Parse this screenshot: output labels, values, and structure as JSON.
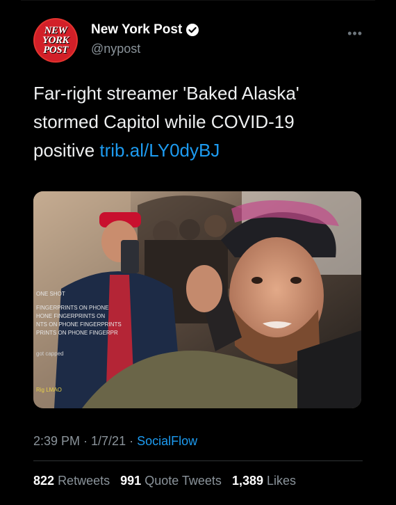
{
  "account": {
    "display_name": "New York Post",
    "handle": "@nypost",
    "logo_lines": [
      "NEW",
      "YORK",
      "POST"
    ],
    "verified": true
  },
  "tweet": {
    "text": "Far-right streamer 'Baked Alaska' stormed Capitol while COVID-19 positive",
    "link": "trib.al/LY0dyBJ",
    "timestamp": "2:39 PM · 1/7/21 · ",
    "source": "SocialFlow"
  },
  "stats": {
    "retweets": "822",
    "retweets_label": "Retweets",
    "quote_tweets": "991",
    "quote_tweets_label": "Quote Tweets",
    "likes": "1,389",
    "likes_label": "Likes"
  },
  "media_overlay": {
    "lines": [
      "ONE SHOT",
      "FINGERPRINTS ON PHONE",
      "HONE FINGERPRINTS ON",
      "NTS ON PHONE FINGERPRINTS",
      "PRINTS ON PHONE FINGERPR",
      "got capped",
      "Rig LMAO"
    ]
  },
  "colors": {
    "background": "#000000",
    "link": "#1d9bf0",
    "secondary_text": "#8b949b",
    "brand_red": "#d21f28"
  },
  "icons": {
    "verified": "verified-badge-icon",
    "more": "more-dots-icon"
  }
}
